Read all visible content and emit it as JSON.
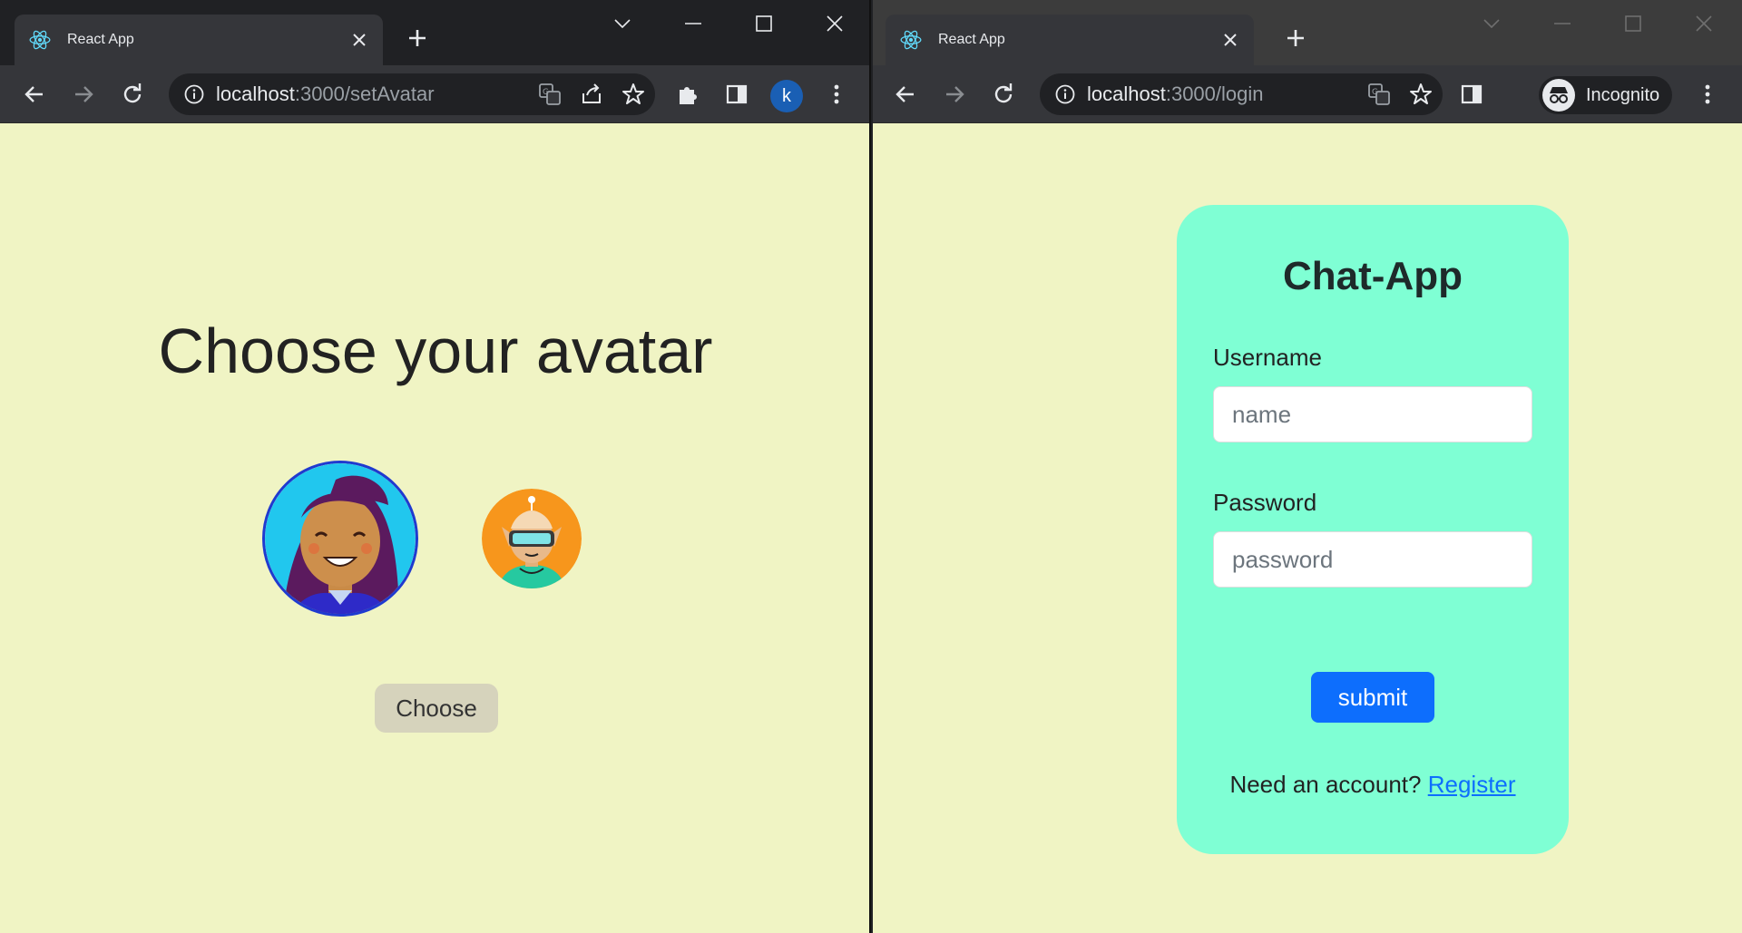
{
  "left_window": {
    "tab": {
      "title": "React App",
      "favicon": "react-logo-icon"
    },
    "address_bar": {
      "host": "localhost",
      "path": ":3000/setAvatar"
    },
    "profile": {
      "initial": "k"
    },
    "page": {
      "heading": "Choose your avatar",
      "avatars": [
        {
          "name": "avatar-woman",
          "selected": true
        },
        {
          "name": "avatar-vr-headset",
          "selected": false
        }
      ],
      "choose_label": "Choose"
    }
  },
  "right_window": {
    "tab": {
      "title": "React App",
      "favicon": "react-logo-icon"
    },
    "address_bar": {
      "host": "localhost",
      "path": ":3000/login"
    },
    "profile": {
      "label": "Incognito"
    },
    "page": {
      "title": "Chat-App",
      "username_label": "Username",
      "username_placeholder": "name",
      "password_label": "Password",
      "password_placeholder": "password",
      "submit_label": "submit",
      "account_prompt": "Need an account?",
      "register_label": "Register"
    }
  },
  "colors": {
    "page_bg": "#f0f4c4",
    "card_bg": "#7fffd4",
    "submit_bg": "#0d6efd",
    "chrome_dark": "#202124",
    "chrome_toolbar": "#35363a"
  }
}
